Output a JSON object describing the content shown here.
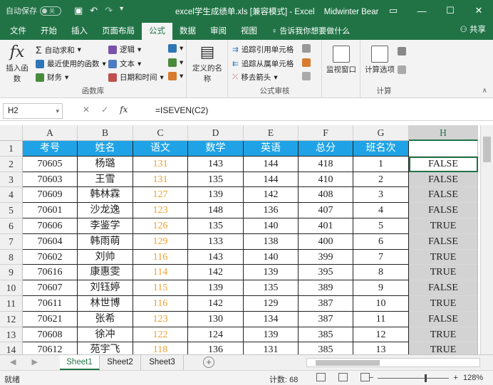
{
  "window": {
    "autosave_label": "自动保存",
    "autosave_state": "关",
    "title": "excel学生成绩单.xls [兼容模式] - Excel",
    "user": "Midwinter Bear"
  },
  "ribbon_tabs": [
    "文件",
    "开始",
    "插入",
    "页面布局",
    "公式",
    "数据",
    "审阅",
    "视图"
  ],
  "tell_me": "告诉我你想要做什么",
  "share_label": "共享",
  "ribbon": {
    "insert_function": "插入函数",
    "autosum": "自动求和",
    "recent": "最近使用的函数",
    "financial": "财务",
    "logical": "逻辑",
    "text": "文本",
    "datetime": "日期和时间",
    "group_library": "函数库",
    "defined_names": "定义的名称",
    "trace_precedents": "追踪引用单元格",
    "trace_dependents": "追踪从属单元格",
    "remove_arrows": "移去箭头",
    "watch_window": "监视窗口",
    "group_audit": "公式审核",
    "calc_options": "计算选项",
    "group_calc": "计算"
  },
  "formula_bar": {
    "name_box": "H2",
    "formula": "=ISEVEN(C2)"
  },
  "columns": [
    "A",
    "B",
    "C",
    "D",
    "E",
    "F",
    "G",
    "H"
  ],
  "row_numbers": [
    "1",
    "2",
    "3",
    "4",
    "5",
    "6",
    "7",
    "8",
    "9",
    "10",
    "11",
    "12",
    "13",
    "14"
  ],
  "table": {
    "headers": [
      "考号",
      "姓名",
      "语文",
      "数学",
      "英语",
      "总分",
      "班名次"
    ],
    "rows": [
      [
        "70605",
        "杨璐",
        "131",
        "143",
        "144",
        "418",
        "1",
        "FALSE"
      ],
      [
        "70603",
        "王雪",
        "131",
        "135",
        "144",
        "410",
        "2",
        "FALSE"
      ],
      [
        "70609",
        "韩林霖",
        "127",
        "139",
        "142",
        "408",
        "3",
        "FALSE"
      ],
      [
        "70601",
        "沙龙逸",
        "123",
        "148",
        "136",
        "407",
        "4",
        "FALSE"
      ],
      [
        "70606",
        "李鉴学",
        "126",
        "135",
        "140",
        "401",
        "5",
        "TRUE"
      ],
      [
        "70604",
        "韩雨萌",
        "129",
        "133",
        "138",
        "400",
        "6",
        "FALSE"
      ],
      [
        "70602",
        "刘帅",
        "116",
        "143",
        "140",
        "399",
        "7",
        "TRUE"
      ],
      [
        "70616",
        "康惠雯",
        "114",
        "142",
        "139",
        "395",
        "8",
        "TRUE"
      ],
      [
        "70607",
        "刘钰婷",
        "115",
        "139",
        "135",
        "389",
        "9",
        "FALSE"
      ],
      [
        "70611",
        "林世博",
        "116",
        "142",
        "129",
        "387",
        "10",
        "TRUE"
      ],
      [
        "70621",
        "张希",
        "123",
        "130",
        "134",
        "387",
        "11",
        "FALSE"
      ],
      [
        "70608",
        "徐冲",
        "122",
        "124",
        "139",
        "385",
        "12",
        "TRUE"
      ],
      [
        "70612",
        "苑宇飞",
        "118",
        "136",
        "131",
        "385",
        "13",
        "TRUE"
      ]
    ]
  },
  "sheets": [
    "Sheet1",
    "Sheet2",
    "Sheet3"
  ],
  "status": {
    "ready": "就绪",
    "count": "计数: 68",
    "zoom": "128%"
  }
}
